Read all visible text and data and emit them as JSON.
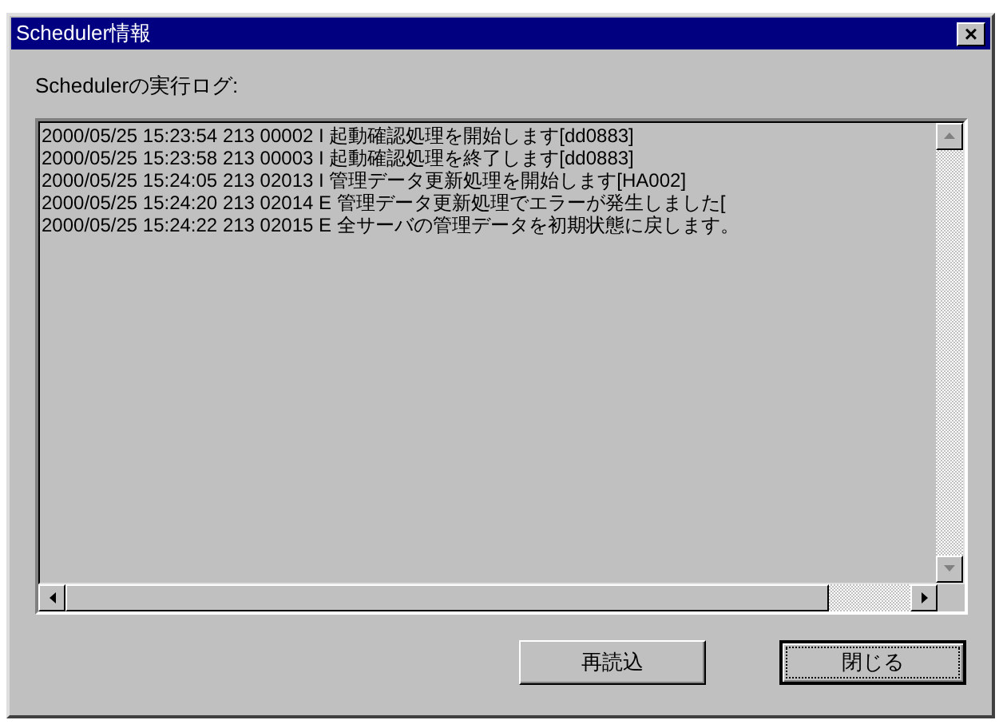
{
  "window": {
    "title": "Scheduler情報",
    "close_glyph": "×"
  },
  "log": {
    "label": "Schedulerの実行ログ:",
    "lines": [
      "2000/05/25 15:23:54 213 00002 I 起動確認処理を開始します[dd0883]",
      "2000/05/25 15:23:58 213 00003 I 起動確認処理を終了します[dd0883]",
      "2000/05/25 15:24:05 213 02013 I 管理データ更新処理を開始します[HA002]",
      "2000/05/25 15:24:20 213 02014 E 管理データ更新処理でエラーが発生しました[",
      "2000/05/25 15:24:22 213 02015 E 全サーバの管理データを初期状態に戻します。"
    ]
  },
  "buttons": [
    {
      "label": "再読込",
      "default": false
    },
    {
      "label": "閉じる",
      "default": true
    }
  ]
}
